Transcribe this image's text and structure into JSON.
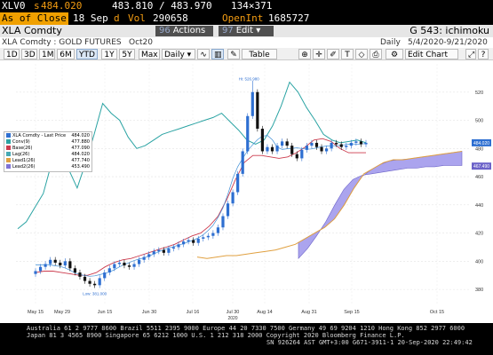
{
  "quote": {
    "ticker": "XLV0",
    "price_prefix": "s",
    "price": "484.020",
    "bid_ask": "483.810 / 483.970",
    "size": "134×371",
    "as_of": "As of Close",
    "date": "18 Sep",
    "date_flag": "d",
    "vol_label": "Vol",
    "vol": "290658",
    "oi_label": "OpenInt",
    "oi": "1685727"
  },
  "titlebar": {
    "ticker": "XLA Comdty",
    "actions_num": "96",
    "actions_label": "Actions",
    "edit_num": "97",
    "edit_label": "Edit",
    "function": "G 543: ichimoku"
  },
  "subheader": {
    "name": "XLA Comdty : GOLD FUTURES",
    "contract": "Oct20",
    "period": "Daily",
    "range": "5/4/2020-9/21/2020"
  },
  "toolbar": {
    "ranges": [
      "1D",
      "3D",
      "1M",
      "6M",
      "YTD",
      "1Y",
      "5Y",
      "Max"
    ],
    "selected": "YTD",
    "freq": "Daily",
    "table": "Table",
    "edit_chart": "Edit Chart"
  },
  "legend": [
    {
      "label": "XLA Comdty - Last Price",
      "value": "484.020",
      "color": "#2e6fd1"
    },
    {
      "label": "Conv(9)",
      "value": "477.880",
      "color": "#2aa3a3"
    },
    {
      "label": "Base(26)",
      "value": "477.090",
      "color": "#cc3b4d"
    },
    {
      "label": "Lag(26)",
      "value": "484.020",
      "color": "#46a9b4"
    },
    {
      "label": "Lead1(26)",
      "value": "477.740",
      "color": "#e0a040"
    },
    {
      "label": "Lead2(26)",
      "value": "453.490",
      "color": "#7f73d6"
    }
  ],
  "annotations": {
    "high": "Hi: 526.980",
    "low": "Low: 381.000",
    "last_price": "484.020",
    "lead2_price": "467.490"
  },
  "chart_data": {
    "type": "candlestick",
    "title": "XLA Comdty : GOLD FUTURES",
    "ylim": [
      370,
      540
    ],
    "y_ticks": [
      380,
      400,
      420,
      440,
      460,
      480,
      500,
      520
    ],
    "x_ticks": [
      "May 15",
      "May 29",
      "Jun 15",
      "Jun 30",
      "Jul 16",
      "Jul 30",
      "Aug 14",
      "Aug 31",
      "Sep 15",
      "Oct 15"
    ],
    "x_year_label": "2020",
    "series_close": [
      393,
      396,
      398,
      401,
      399,
      397,
      400,
      395,
      392,
      389,
      386,
      384,
      383,
      388,
      392,
      395,
      398,
      399,
      397,
      396,
      398,
      401,
      403,
      405,
      407,
      408,
      406,
      409,
      410,
      412,
      414,
      415,
      413,
      416,
      417,
      418,
      420,
      424,
      432,
      441,
      449,
      462,
      478,
      503,
      520,
      494,
      478,
      481,
      478,
      482,
      485,
      482,
      476,
      473,
      479,
      482,
      484,
      481,
      478,
      480,
      484,
      483,
      481,
      482,
      484,
      485,
      483,
      484
    ],
    "conv_line": [
      500,
      505,
      515,
      522,
      508,
      490,
      470,
      458,
      462,
      475,
      488,
      495,
      510,
      520,
      510,
      495,
      485,
      483,
      482,
      486,
      488,
      487,
      489,
      491,
      494,
      496,
      498,
      500,
      503,
      505,
      504,
      500,
      496,
      484,
      480,
      483,
      490,
      500,
      510,
      520,
      515,
      505,
      500,
      495,
      488,
      484,
      483,
      485,
      486,
      484,
      485,
      484
    ],
    "base_line": [
      392,
      393,
      393,
      392,
      391,
      390,
      390,
      392,
      396,
      399,
      401,
      402,
      404,
      406,
      408,
      410,
      412,
      415,
      418,
      420,
      425,
      432,
      444,
      458,
      470,
      475,
      475,
      474,
      473,
      474,
      477,
      481,
      486,
      487,
      485,
      480,
      477,
      477,
      477
    ],
    "lead1": [
      403,
      402,
      403,
      404,
      404,
      405,
      406,
      407,
      408,
      410,
      412,
      416,
      420,
      424,
      430,
      440,
      452,
      462,
      466,
      470,
      472,
      472,
      473,
      474,
      475,
      476,
      477,
      478
    ],
    "lead2": [
      402,
      409,
      418,
      428,
      440,
      451,
      458,
      461,
      462,
      463,
      464,
      465,
      466,
      466,
      467,
      467,
      468,
      468,
      468
    ]
  },
  "footer": {
    "line1": "Australia 61 2 9777 8600  Brazil 5511 2395 9000  Europe 44 20 7330 7500  Germany 49 69 9204 1210  Hong Kong 852 2977 6000",
    "line2": "Japan 81 3 4565 8900        Singapore 65 6212 1000       U.S. 1 212 318 2000       Copyright 2020 Bloomberg Finance L.P.",
    "line3": "SN 926264 AST  GMT+3:00 G671-3911-1 20-Sep-2020 22:49:42"
  },
  "colors": {
    "price_up": "#2e6fd1",
    "price_down": "#111111",
    "conv": "#2aa3a3",
    "base": "#cc3b4d",
    "lead1": "#e0a040",
    "cloud": "#8f86e8"
  }
}
